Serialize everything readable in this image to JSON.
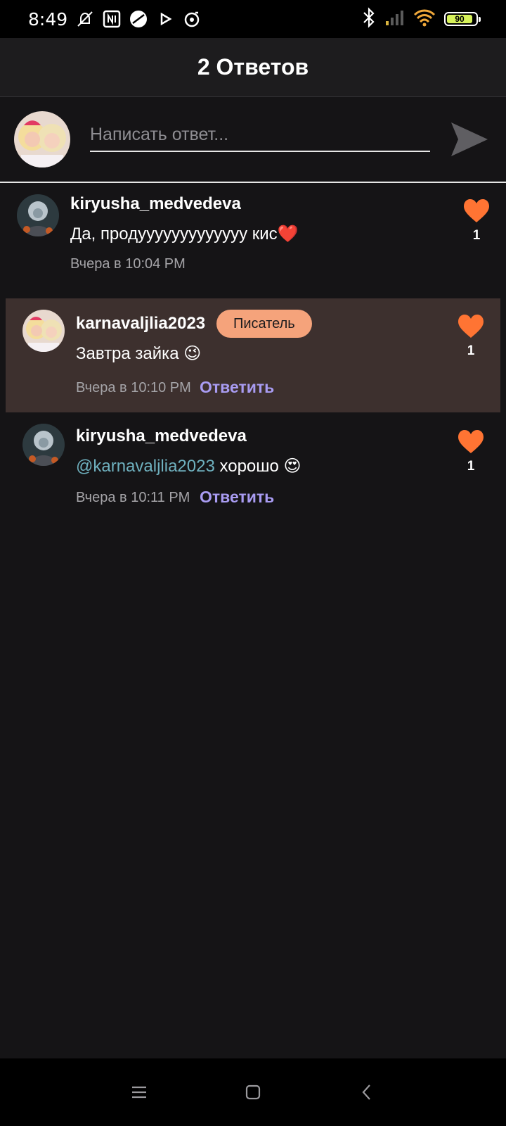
{
  "status_bar": {
    "time": "8:49",
    "battery_level": "90",
    "icons": [
      "muted-bell-icon",
      "nfc-icon",
      "app-icon",
      "play-icon",
      "media-icon",
      "bluetooth-icon",
      "signal-icon",
      "wifi-icon"
    ]
  },
  "header": {
    "title": "2 Ответов"
  },
  "composer": {
    "placeholder": "Написать ответ...",
    "value": ""
  },
  "comments": [
    {
      "username": "kiryusha_medvedeva",
      "text": "Да, продууууууууууууу кис",
      "emoji": "❤️",
      "time": "Вчера в 10:04 PM",
      "likes": "1"
    },
    {
      "username": "karnavaljlia2023",
      "badge": "Писатель",
      "text": "Завтра зайка",
      "emoji": "😉",
      "time": "Вчера в 10:10 PM",
      "reply_label": "Ответить",
      "likes": "1"
    },
    {
      "username": "kiryusha_medvedeva",
      "mention": "@karnavaljlia2023",
      "text": "хорошо",
      "emoji": "😍",
      "time": "Вчера в 10:11 PM",
      "reply_label": "Ответить",
      "likes": "1"
    }
  ],
  "colors": {
    "background": "#151416",
    "header": "#1d1c1e",
    "highlight": "#3d302e",
    "heart": "#ff7433",
    "reply": "#a99cf2",
    "mention": "#6fb1bf",
    "badge": "#f5a37b"
  }
}
